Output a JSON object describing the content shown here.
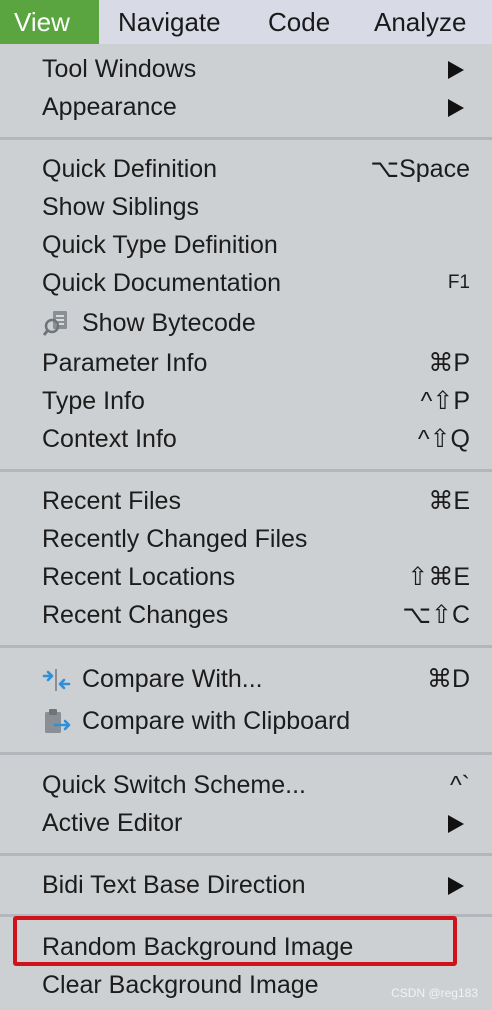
{
  "menubar": {
    "items": [
      {
        "label": "View",
        "active": true
      },
      {
        "label": "Navigate"
      },
      {
        "label": "Code"
      },
      {
        "label": "Analyze"
      }
    ]
  },
  "menu": {
    "tool_windows": "Tool Windows",
    "appearance": "Appearance",
    "quick_definition": "Quick Definition",
    "quick_definition_shortcut": "⌥Space",
    "show_siblings": "Show Siblings",
    "quick_type_definition": "Quick Type Definition",
    "quick_documentation": "Quick Documentation",
    "quick_documentation_shortcut": "F1",
    "show_bytecode": "Show Bytecode",
    "parameter_info": "Parameter Info",
    "parameter_info_shortcut": "⌘P",
    "type_info": "Type Info",
    "type_info_shortcut": "^⇧P",
    "context_info": "Context Info",
    "context_info_shortcut": "^⇧Q",
    "recent_files": "Recent Files",
    "recent_files_shortcut": "⌘E",
    "recently_changed_files": "Recently Changed Files",
    "recent_locations": "Recent Locations",
    "recent_locations_shortcut": "⇧⌘E",
    "recent_changes": "Recent Changes",
    "recent_changes_shortcut": "⌥⇧C",
    "compare_with": "Compare With...",
    "compare_with_shortcut": "⌘D",
    "compare_with_clipboard": "Compare with Clipboard",
    "quick_switch_scheme": "Quick Switch Scheme...",
    "quick_switch_scheme_shortcut": "^`",
    "active_editor": "Active Editor",
    "bidi_text_base_direction": "Bidi Text Base Direction",
    "random_background_image": "Random Background Image",
    "clear_background_image": "Clear Background Image"
  },
  "icons": {
    "show_bytecode": "bytecode-search-icon",
    "compare_with": "compare-arrows-icon",
    "compare_with_clipboard": "clipboard-compare-icon",
    "submenu": "submenu-arrow-icon"
  },
  "colors": {
    "menubar_active": "#5aa53f",
    "menu_background": "#cdd0d3",
    "highlight_border": "#d0121a",
    "icon_blue": "#2f8fd8"
  },
  "watermark": "CSDN @reg183"
}
